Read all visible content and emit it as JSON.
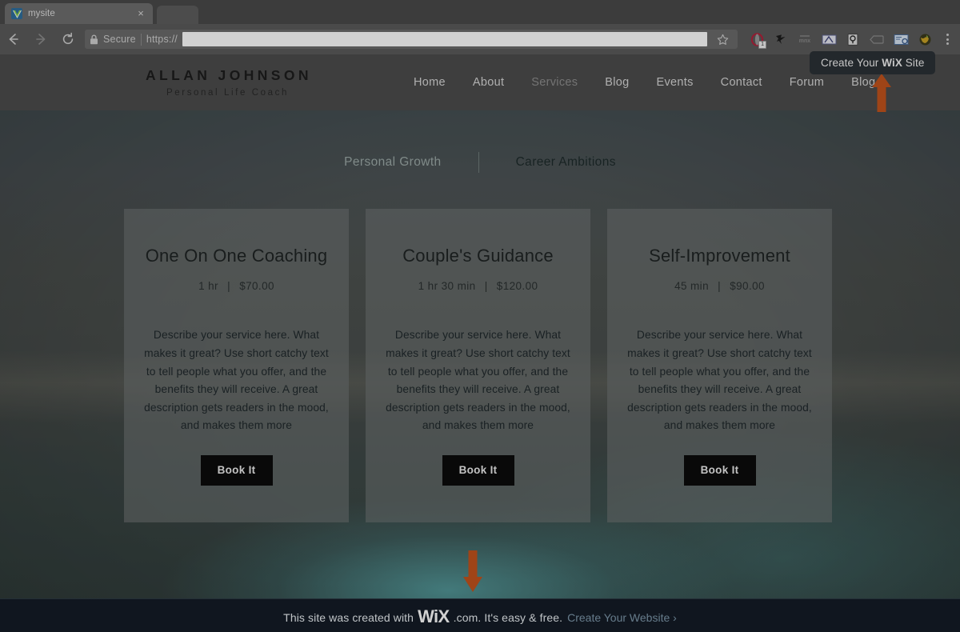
{
  "browser": {
    "tab": {
      "title": "mysite",
      "favicon": "wix-favicon",
      "close": "×"
    },
    "back_icon": "back-arrow-icon",
    "forward_icon": "forward-arrow-icon",
    "reload_icon": "reload-icon",
    "omnibox": {
      "lock_icon": "lock-icon",
      "secure_label": "Secure",
      "scheme": "https://",
      "url_value": "",
      "redacted": true
    },
    "bookmark_icon": "star-icon",
    "extensions": [
      {
        "name": "opera-extension-icon",
        "badge": "1"
      },
      {
        "name": "bird-extension-icon",
        "badge": ""
      },
      {
        "name": "mnx-extension-icon",
        "badge": ""
      },
      {
        "name": "ruler-extension-icon",
        "badge": ""
      },
      {
        "name": "pin-extension-icon",
        "badge": ""
      },
      {
        "name": "tag-extension-icon",
        "badge": ""
      },
      {
        "name": "screenshot-extension-icon",
        "badge": ""
      },
      {
        "name": "globe-extension-icon",
        "badge": ""
      }
    ],
    "menu_icon": "three-dot-menu-icon"
  },
  "tooltip": {
    "prefix": "Create Your ",
    "brand": "WiX",
    "suffix": " Site"
  },
  "site": {
    "logo": {
      "name": "ALLAN JOHNSON",
      "tagline": "Personal Life Coach"
    },
    "nav": [
      {
        "label": "Home",
        "active": false
      },
      {
        "label": "About",
        "active": false
      },
      {
        "label": "Services",
        "active": true
      },
      {
        "label": "Blog",
        "active": false
      },
      {
        "label": "Events",
        "active": false
      },
      {
        "label": "Contact",
        "active": false
      },
      {
        "label": "Forum",
        "active": false
      },
      {
        "label": "Blog",
        "active": false
      }
    ]
  },
  "categories": [
    {
      "label": "Personal Growth",
      "selected": false
    },
    {
      "label": "Career Ambitions",
      "selected": true
    }
  ],
  "services": [
    {
      "title": "One On One Coaching",
      "duration": "1 hr",
      "separator": "|",
      "price": "$70.00",
      "description": "Describe your service here. What makes it great? Use short catchy text to tell people what you offer, and the benefits they will receive. A great description gets readers in the mood, and makes them more",
      "button": "Book It"
    },
    {
      "title": "Couple's Guidance",
      "duration": "1 hr 30 min",
      "separator": "|",
      "price": "$120.00",
      "description": "Describe your service here. What makes it great? Use short catchy text to tell people what you offer, and the benefits they will receive. A great description gets readers in the mood, and makes them more",
      "button": "Book It"
    },
    {
      "title": "Self-Improvement",
      "duration": "45 min",
      "separator": "|",
      "price": "$90.00",
      "description": "Describe your service here. What makes it great? Use short catchy text to tell people what you offer, and the benefits they will receive. A great description gets readers in the mood, and makes them more",
      "button": "Book It"
    }
  ],
  "wix_banner": {
    "text_before": "This site was created with",
    "brand": "WiX",
    "text_after": ".com. It's easy & free.",
    "link": "Create Your Website ›"
  },
  "annotations": {
    "arrow_up": "orange-up-arrow",
    "arrow_down": "orange-down-arrow",
    "arrow_color": "#c2531d"
  },
  "colors": {
    "accent_orange": "#c2531d",
    "tooltip_bg": "#2b3136",
    "banner_bg": "#141c26",
    "banner_link": "#7e98ab",
    "card_bg": "rgba(112,116,117,.62)",
    "button_bg": "#0b0b0b",
    "header_bg": "#4c4c4c"
  }
}
